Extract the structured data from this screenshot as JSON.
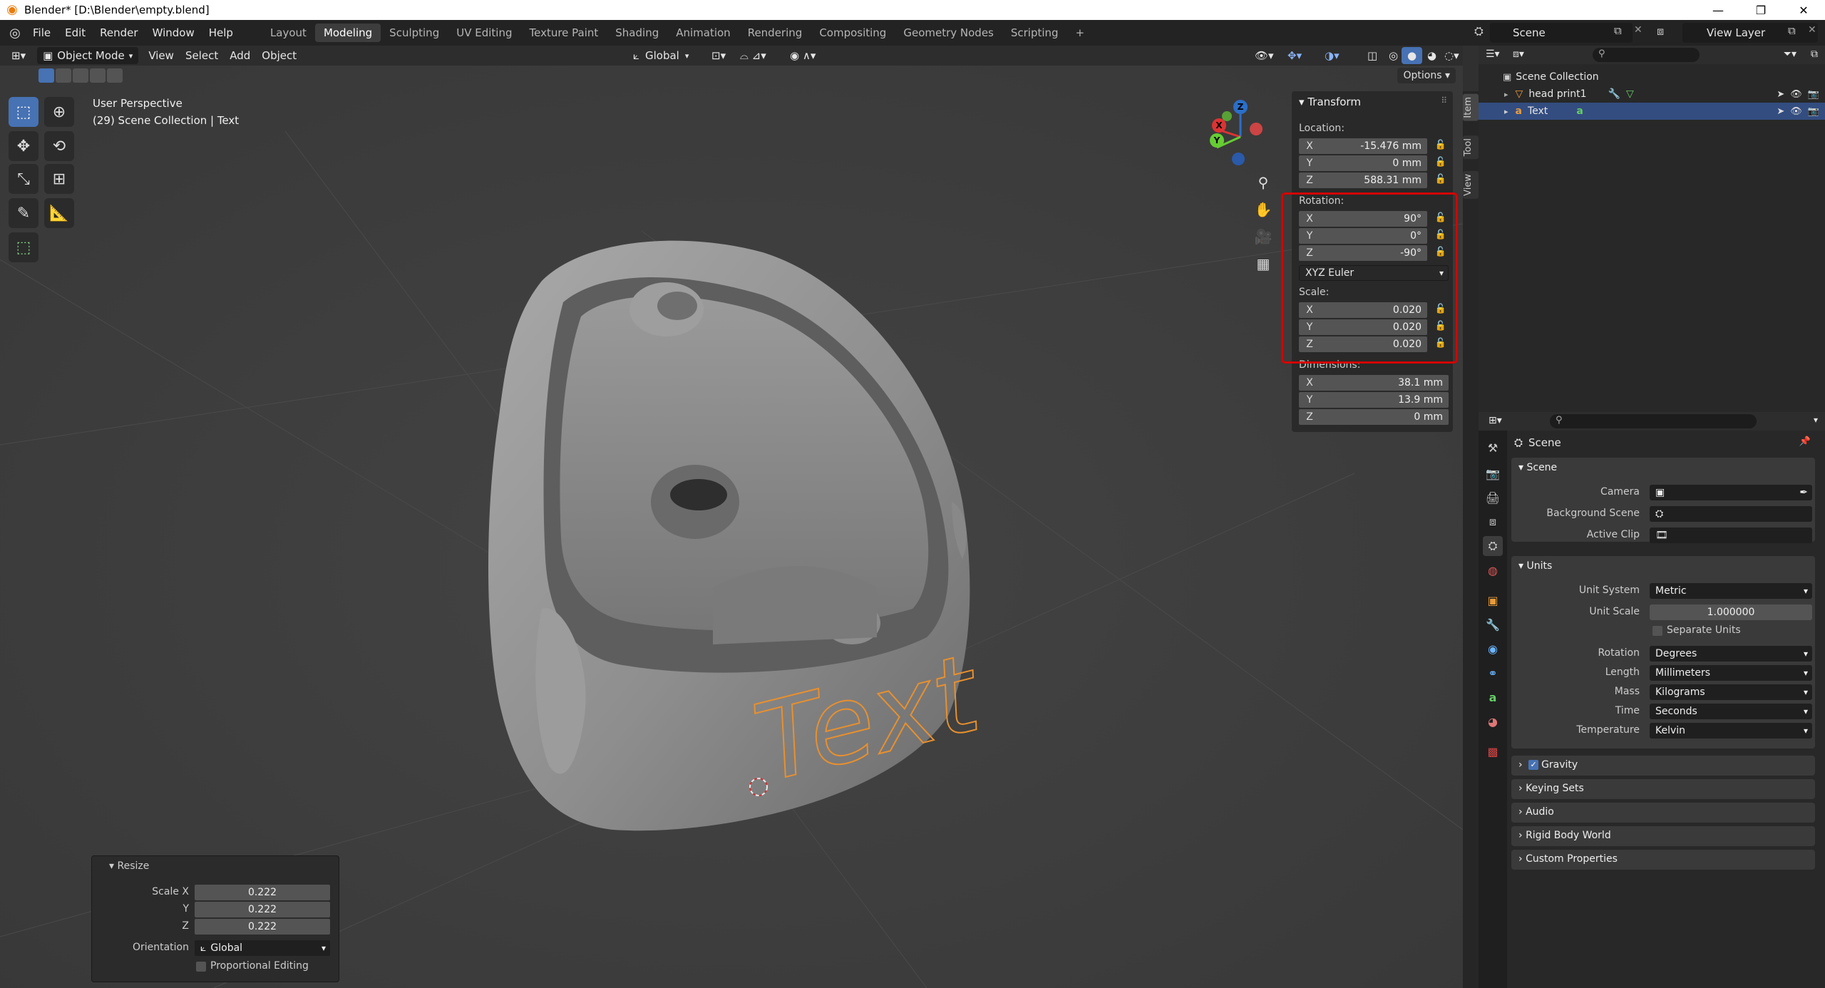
{
  "window": {
    "title": "Blender* [D:\\Blender\\empty.blend]",
    "minimize": "—",
    "restore": "❐",
    "close": "✕"
  },
  "topbar": {
    "menus": [
      "File",
      "Edit",
      "Render",
      "Window",
      "Help"
    ],
    "workspaces": [
      "Layout",
      "Modeling",
      "Sculpting",
      "UV Editing",
      "Texture Paint",
      "Shading",
      "Animation",
      "Rendering",
      "Compositing",
      "Geometry Nodes",
      "Scripting"
    ],
    "active_workspace": "Modeling",
    "add_tab": "+",
    "scene": "Scene",
    "view_layer": "View Layer"
  },
  "viewport_header": {
    "mode": "Object Mode",
    "menus": [
      "View",
      "Select",
      "Add",
      "Object"
    ],
    "orientation": "Global",
    "options": "Options"
  },
  "viewport": {
    "perspective": "User Perspective",
    "collection_info": "(29) Scene Collection | Text",
    "text_object": "Text",
    "gizmo": {
      "x": "X",
      "y": "Y",
      "z": "Z"
    }
  },
  "npanel": {
    "title": "Transform",
    "location_label": "Location:",
    "location": [
      {
        "ax": "X",
        "val": "-15.476 mm"
      },
      {
        "ax": "Y",
        "val": "0 mm"
      },
      {
        "ax": "Z",
        "val": "588.31 mm"
      }
    ],
    "rotation_label": "Rotation:",
    "rotation": [
      {
        "ax": "X",
        "val": "90°"
      },
      {
        "ax": "Y",
        "val": "0°"
      },
      {
        "ax": "Z",
        "val": "-90°"
      }
    ],
    "rotation_mode": "XYZ Euler",
    "scale_label": "Scale:",
    "scale": [
      {
        "ax": "X",
        "val": "0.020"
      },
      {
        "ax": "Y",
        "val": "0.020"
      },
      {
        "ax": "Z",
        "val": "0.020"
      }
    ],
    "dimensions_label": "Dimensions:",
    "dimensions": [
      {
        "ax": "X",
        "val": "38.1 mm"
      },
      {
        "ax": "Y",
        "val": "13.9 mm"
      },
      {
        "ax": "Z",
        "val": "0 mm"
      }
    ],
    "tabs": [
      "Item",
      "Tool",
      "View"
    ]
  },
  "resize_panel": {
    "title": "Resize",
    "scale_x_label": "Scale X",
    "y_label": "Y",
    "z_label": "Z",
    "scale_x": "0.222",
    "scale_y": "0.222",
    "scale_z": "0.222",
    "orientation_label": "Orientation",
    "orientation": "Global",
    "proportional": "Proportional Editing"
  },
  "outliner": {
    "root": "Scene Collection",
    "items": [
      "head print1",
      "Text"
    ]
  },
  "properties": {
    "context": "Scene",
    "scene_section": "Scene",
    "camera_label": "Camera",
    "bg_scene_label": "Background Scene",
    "active_clip_label": "Active Clip",
    "units_section": "Units",
    "unit_system_label": "Unit System",
    "unit_system": "Metric",
    "unit_scale_label": "Unit Scale",
    "unit_scale": "1.000000",
    "separate_units": "Separate Units",
    "rotation_label": "Rotation",
    "rotation": "Degrees",
    "length_label": "Length",
    "length": "Millimeters",
    "mass_label": "Mass",
    "mass": "Kilograms",
    "time_label": "Time",
    "time": "Seconds",
    "temperature_label": "Temperature",
    "temperature": "Kelvin",
    "collapsed_sections": [
      "Gravity",
      "Keying Sets",
      "Audio",
      "Rigid Body World",
      "Custom Properties"
    ]
  }
}
